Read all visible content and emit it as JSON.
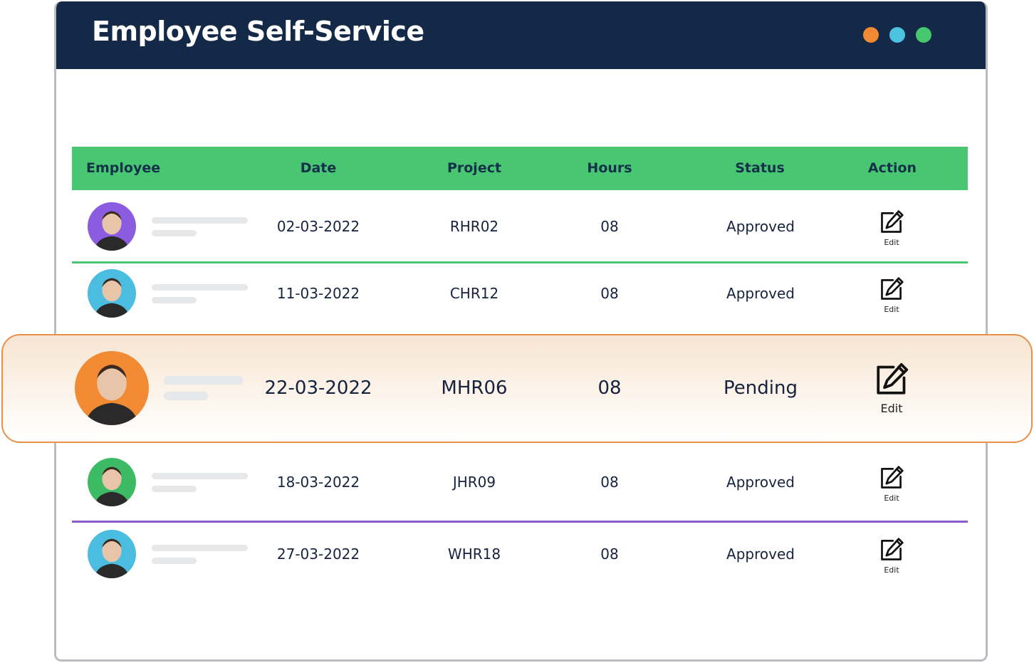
{
  "window": {
    "title": "Employee Self-Service",
    "controls": [
      {
        "name": "orange-dot",
        "color": "#f28a33"
      },
      {
        "name": "blue-dot",
        "color": "#4bc3e0"
      },
      {
        "name": "green-dot",
        "color": "#47c76e"
      }
    ]
  },
  "table": {
    "columns": [
      "Employee",
      "Date",
      "Project",
      "Hours",
      "Status",
      "Action"
    ],
    "rows": [
      {
        "avatar_color": "#8b5be0",
        "date": "02-03-2022",
        "project": "RHR02",
        "hours": "08",
        "status": "Approved",
        "action": "Edit"
      },
      {
        "avatar_color": "#4bbde0",
        "date": "11-03-2022",
        "project": "CHR12",
        "hours": "08",
        "status": "Approved",
        "action": "Edit"
      },
      {
        "avatar_color": "#f28a33",
        "date": "22-03-2022",
        "project": "MHR06",
        "hours": "08",
        "status": "Pending",
        "action": "Edit",
        "highlighted": true
      },
      {
        "avatar_color": "#3dbb64",
        "date": "18-03-2022",
        "project": "JHR09",
        "hours": "08",
        "status": "Approved",
        "action": "Edit"
      },
      {
        "avatar_color": "#4bbde0",
        "date": "27-03-2022",
        "project": "WHR18",
        "hours": "08",
        "status": "Approved",
        "action": "Edit"
      }
    ],
    "separator_colors": [
      "#48c672",
      "#e8904a",
      "#8b5cc9"
    ]
  }
}
